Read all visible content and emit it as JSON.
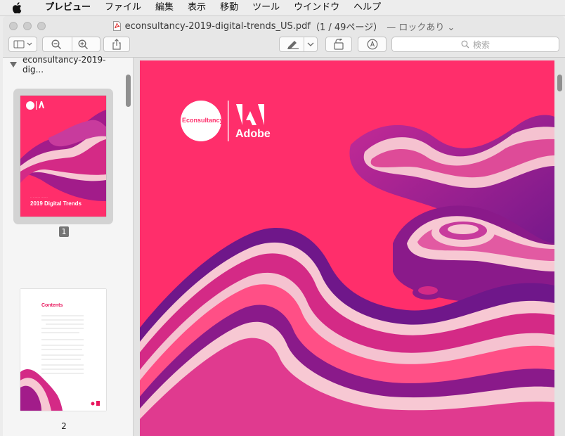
{
  "menubar": {
    "items": [
      {
        "label": "プレビュー",
        "bold": true
      },
      {
        "label": "ファイル"
      },
      {
        "label": "編集"
      },
      {
        "label": "表示"
      },
      {
        "label": "移動"
      },
      {
        "label": "ツール"
      },
      {
        "label": "ウインドウ"
      },
      {
        "label": "ヘルプ"
      }
    ]
  },
  "window": {
    "filename": "econsultancy-2019-digital-trends_US.pdf",
    "page_info": "（1 / 49ページ）",
    "lock_state": "— ロックあり ⌄"
  },
  "toolbar": {
    "search_placeholder": "検索"
  },
  "sidebar": {
    "header": "econsultancy-2019-dig...",
    "pages": [
      {
        "badge": "1",
        "selected": true,
        "cover_title": "2019 Digital Trends"
      },
      {
        "badge": "2",
        "selected": false,
        "contents_title": "Contents"
      }
    ]
  },
  "document": {
    "logo_text": "Econsultancy",
    "brand": "Adobe"
  },
  "colors": {
    "brand_pink": "#ff2e6b",
    "wave_purple": "#8a1a8a",
    "adobe_red": "#e8175d"
  }
}
